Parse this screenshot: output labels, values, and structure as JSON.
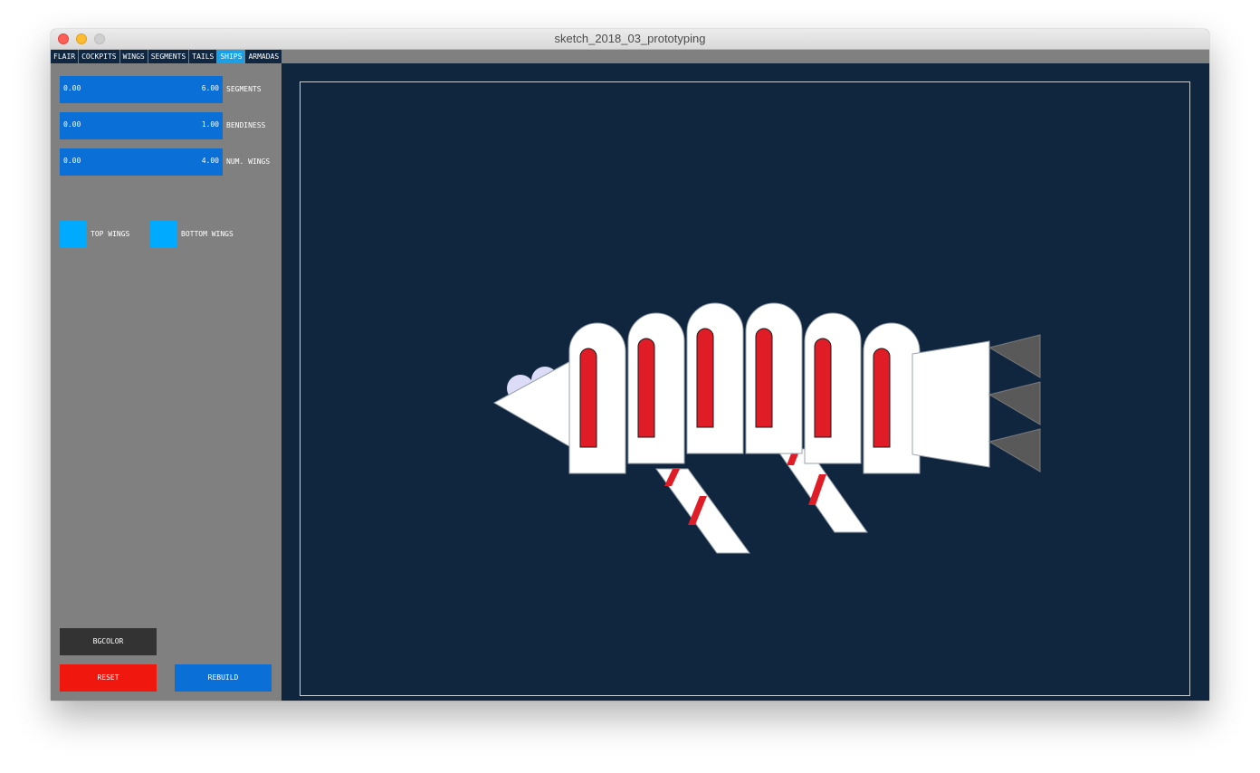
{
  "window": {
    "title": "sketch_2018_03_prototyping"
  },
  "tabs": [
    {
      "label": "FLAIR",
      "active": false
    },
    {
      "label": "COCKPITS",
      "active": false
    },
    {
      "label": "WINGS",
      "active": false
    },
    {
      "label": "SEGMENTS",
      "active": false
    },
    {
      "label": "TAILS",
      "active": false
    },
    {
      "label": "SHIPS",
      "active": true
    },
    {
      "label": "ARMADAS",
      "active": false
    }
  ],
  "sliders": [
    {
      "min": "0.00",
      "max": "6.00",
      "label": "SEGMENTS"
    },
    {
      "min": "0.00",
      "max": "1.00",
      "label": "BENDINESS"
    },
    {
      "min": "0.00",
      "max": "4.00",
      "label": "NUM. WINGS"
    }
  ],
  "toggles": [
    {
      "label": "TOP WINGS"
    },
    {
      "label": "BOTTOM WINGS"
    }
  ],
  "buttons": {
    "bgcolor": "BGCOLOR",
    "reset": "RESET",
    "rebuild": "REBUILD"
  },
  "colors": {
    "canvas_bg": "#10253e",
    "panel_bg": "#808080",
    "slider": "#0a6fd6",
    "toggle": "#00aaff",
    "reset": "#f0170f",
    "rebuild": "#0a6fd6",
    "bgcolor_btn": "#333333",
    "ship_body": "#ffffff",
    "ship_stripe": "#e01c26",
    "tail_fin": "#595959",
    "cockpit_bubble": "#dcdcf8"
  }
}
